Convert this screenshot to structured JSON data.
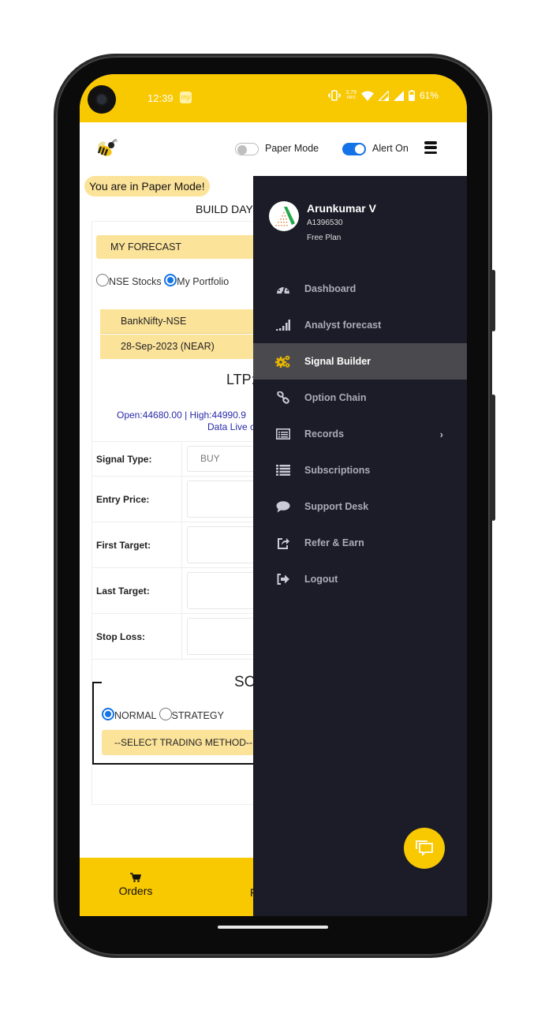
{
  "status_bar": {
    "time": "12:39",
    "app_badge": "my",
    "net_speed_value": "3.79",
    "net_speed_unit": "KB/S",
    "battery": "61%"
  },
  "header": {
    "logo_icon": "bee-icon",
    "paper_mode_label": "Paper Mode",
    "paper_mode_on": false,
    "alert_label": "Alert On",
    "alert_on": true
  },
  "main": {
    "paper_banner": "You are in Paper Mode!",
    "title_partial": "BUILD DAY",
    "forecast_label": "MY FORECAST",
    "source_options": [
      {
        "label": "NSE Stocks",
        "selected": false
      },
      {
        "label": "My Portfolio",
        "selected": true
      }
    ],
    "instrument": "BankNifty-NSE",
    "expiry": "28-Sep-2023 (NEAR)",
    "ltp_label": "LTP:",
    "ohlc_text": "Open:44680.00 | High:44990.9",
    "data_live_text": "Data Live c",
    "form": [
      {
        "label": "Signal Type:",
        "value": "BUY"
      },
      {
        "label": "Entry Price:",
        "value": ""
      },
      {
        "label": "First Target:",
        "value": ""
      },
      {
        "label": "Last Target:",
        "value": ""
      },
      {
        "label": "Stop Loss:",
        "value": ""
      }
    ],
    "section_title_partial": "SC",
    "method_options": [
      {
        "label": "NORMAL",
        "selected": true
      },
      {
        "label": "STRATEGY",
        "selected": false
      }
    ],
    "select_method_label": "--SELECT TRADING METHOD--"
  },
  "bottom_nav": {
    "items": [
      {
        "label": "Orders",
        "icon": "cart-icon"
      },
      {
        "label": "F",
        "icon": ""
      }
    ]
  },
  "drawer": {
    "user_name": "Arunkumar V",
    "user_id": "A1396530",
    "plan": "Free Plan",
    "items": [
      {
        "label": "Dashboard",
        "icon": "dashboard-icon",
        "active": false
      },
      {
        "label": "Analyst forecast",
        "icon": "signal-bars-icon",
        "active": false
      },
      {
        "label": "Signal Builder",
        "icon": "gears-icon",
        "active": true
      },
      {
        "label": "Option Chain",
        "icon": "link-icon",
        "active": false
      },
      {
        "label": "Records",
        "icon": "records-icon",
        "active": false,
        "has_submenu": true
      },
      {
        "label": "Subscriptions",
        "icon": "list-icon",
        "active": false
      },
      {
        "label": "Support Desk",
        "icon": "chat-bubble-icon",
        "active": false
      },
      {
        "label": "Refer & Earn",
        "icon": "share-icon",
        "active": false
      },
      {
        "label": "Logout",
        "icon": "logout-icon",
        "active": false
      }
    ]
  },
  "colors": {
    "brand_yellow": "#f8c800",
    "pale_yellow": "#fce39a",
    "drawer_bg": "#1c1c28",
    "active_item_bg": "#4a4a4e",
    "accent_blue": "#1473e6"
  }
}
